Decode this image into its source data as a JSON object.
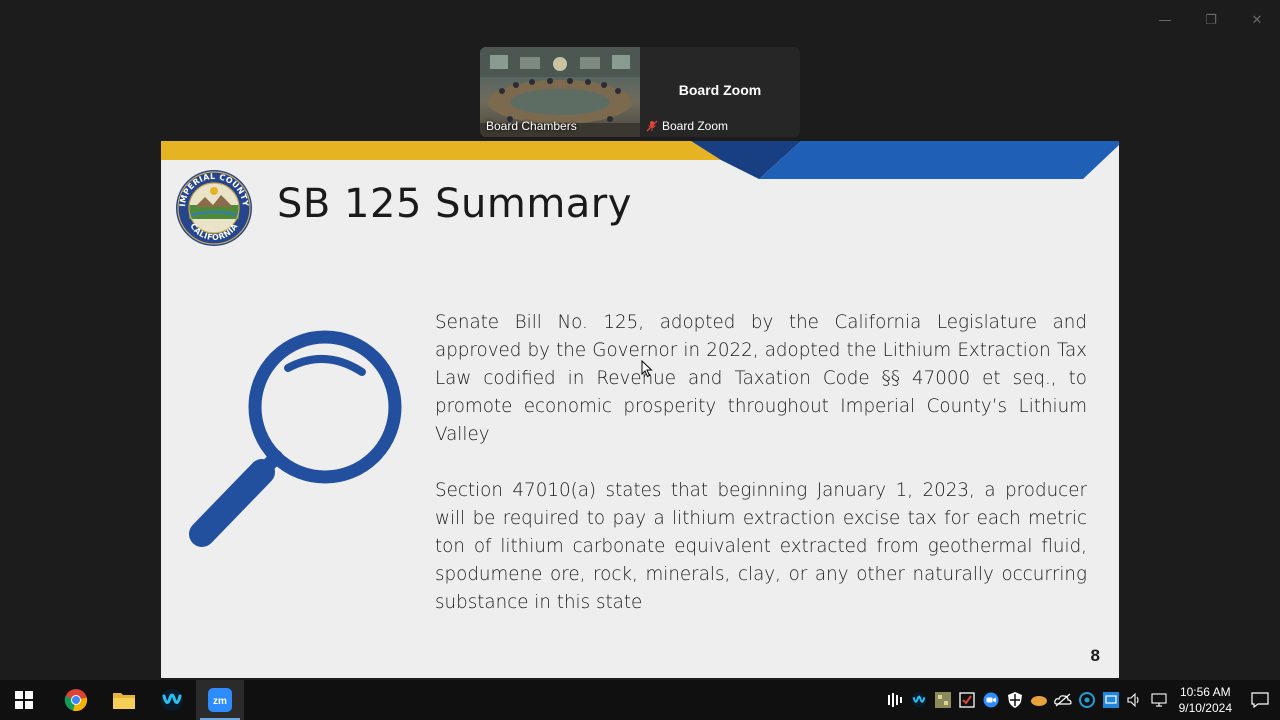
{
  "window": {
    "minimize": "—",
    "restore": "❐",
    "close": "✕"
  },
  "video_strip": {
    "camera_tile": {
      "label": "Board Chambers"
    },
    "zoom_tile": {
      "name": "Board Zoom",
      "label": "Board Zoom"
    }
  },
  "slide": {
    "title": "SB 125 Summary",
    "logo": {
      "text_top": "IMPERIAL COUNTY",
      "text_bottom": "CALIFORNIA"
    },
    "paragraph_1": "Senate Bill No. 125, adopted by the California Legislature and approved by the Governor in 2022, adopted the Lithium Extraction Tax Law codified in Revenue and Taxation Code §§ 47000 et seq., to promote economic prosperity throughout Imperial County’s Lithium Valley",
    "paragraph_2": "Section 47010(a) states that beginning January 1, 2023, a producer will be required to pay a lithium extraction excise tax for each metric ton of lithium carbonate equivalent extracted from geothermal fluid, spodumene ore, rock, minerals, clay, or any other naturally occurring substance in this state",
    "page_number": "8",
    "colors": {
      "banner_gold": "#e6b422",
      "banner_blue": "#1f5fb6",
      "banner_navy": "#173f82",
      "icon_blue": "#22509f"
    }
  },
  "taskbar": {
    "apps": [
      "start-icon",
      "chrome-icon",
      "file-explorer-icon",
      "webex-icon",
      "zoom-icon"
    ],
    "zoom_label": "zm",
    "clock": {
      "time": "10:56 AM",
      "date": "9/10/2024"
    }
  }
}
